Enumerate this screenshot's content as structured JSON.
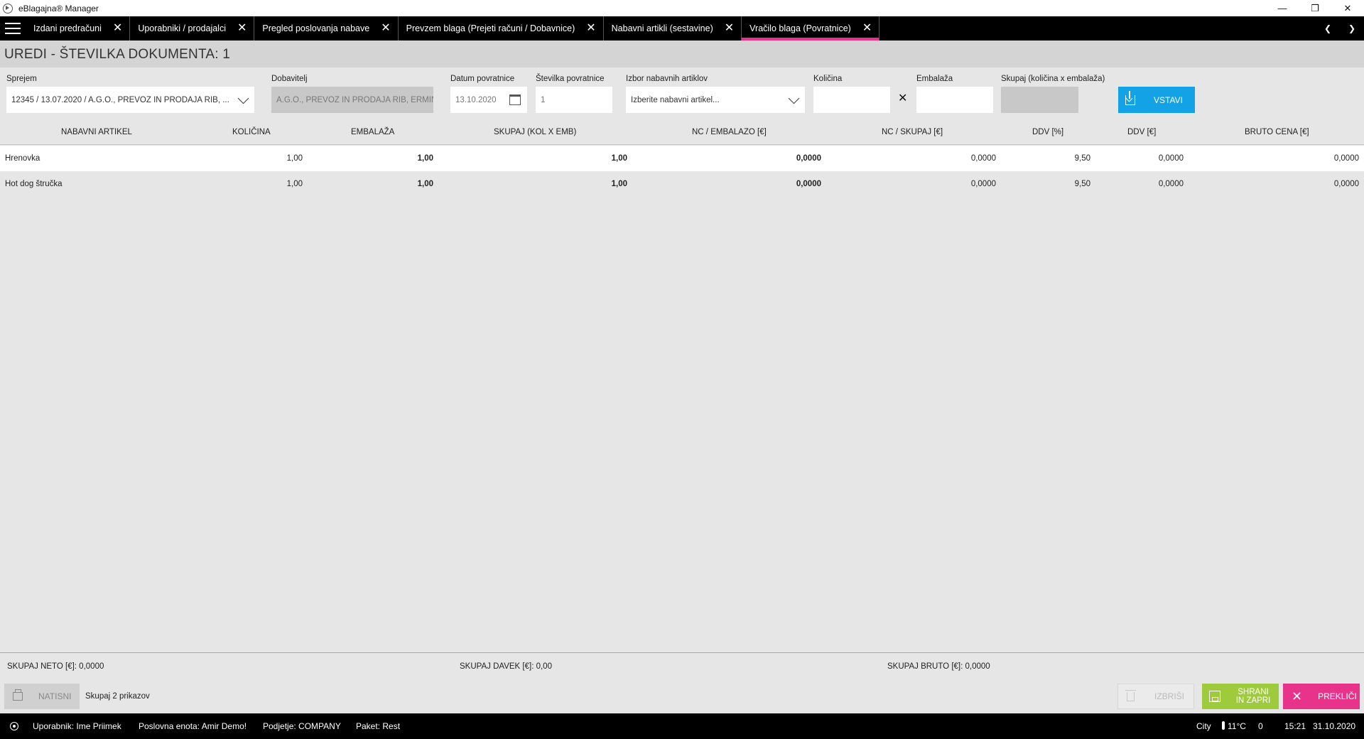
{
  "window": {
    "title": "eBlagajna® Manager",
    "minimize": "—",
    "restore": "❐",
    "close": "✕"
  },
  "tabs": [
    {
      "label": "Izdani predračuni",
      "active": false
    },
    {
      "label": "Uporabniki / prodajalci",
      "active": false
    },
    {
      "label": "Pregled poslovanja nabave",
      "active": false
    },
    {
      "label": "Prevzem blaga (Prejeti računi / Dobavnice)",
      "active": false
    },
    {
      "label": "Nabavni artikli (sestavine)",
      "active": false
    },
    {
      "label": "Vračilo blaga (Povratnice)",
      "active": true
    }
  ],
  "tab_close": "✕",
  "tab_nav": {
    "prev": "❮",
    "next": "❯"
  },
  "page": {
    "title": "UREDI - ŠTEVILKA DOKUMENTA: 1"
  },
  "form": {
    "sprejem_label": "Sprejem",
    "sprejem_value": "12345 / 13.07.2020 / A.G.O., PREVOZ IN PRODAJA RIB, ...",
    "dobavitelj_label": "Dobavitelj",
    "dobavitelj_value": "A.G.O., PREVOZ IN PRODAJA RIB, ERMIN",
    "datum_label": "Datum povratnice",
    "datum_value": "13.10.2020",
    "stevilka_label": "Številka povratnice",
    "stevilka_value": "1",
    "izbor_label": "Izbor nabavnih artiklov",
    "izbor_placeholder": "Izberite nabavni artikel...",
    "kolicina_label": "Količina",
    "kolicina_value": "",
    "multiply_sign": "✕",
    "embalaza_label": "Embalaža",
    "embalaza_value": "",
    "skupaj_label": "Skupaj (količina x embalaža)",
    "skupaj_value": "",
    "insert_button": "VSTAVI"
  },
  "table": {
    "columns": [
      "NABAVNI ARTIKEL",
      "KOLIČINA",
      "EMBALAŽA",
      "SKUPAJ (KOL X EMB)",
      "NC / EMBALAZO [€]",
      "NC / SKUPAJ [€]",
      "DDV [%]",
      "DDV [€]",
      "BRUTO CENA [€]"
    ],
    "rows": [
      {
        "artikel": "Hrenovka",
        "kolicina": "1,00",
        "embalaza": "1,00",
        "skupaj": "1,00",
        "nc_emb": "0,0000",
        "nc_skupaj": "0,0000",
        "ddv_pct": "9,50",
        "ddv_eur": "0,0000",
        "bruto": "0,0000"
      },
      {
        "artikel": "Hot dog štručka",
        "kolicina": "1,00",
        "embalaza": "1,00",
        "skupaj": "1,00",
        "nc_emb": "0,0000",
        "nc_skupaj": "0,0000",
        "ddv_pct": "9,50",
        "ddv_eur": "0,0000",
        "bruto": "0,0000"
      }
    ]
  },
  "totals": {
    "neto": "SKUPAJ NETO [€]: 0,0000",
    "davek": "SKUPAJ DAVEK [€]: 0,00",
    "bruto": "SKUPAJ BRUTO [€]: 0,0000"
  },
  "actions": {
    "print": "NATISNI",
    "count": "Skupaj 2 prikazov",
    "delete": "IZBRIŠI",
    "save": "SHRANI IN ZAPRI",
    "cancel": "PREKLIČI"
  },
  "status": {
    "user": "Uporabnik: Ime Priimek",
    "unit": "Poslovna enota: Amir Demo!",
    "company": "Podjetje: COMPANY",
    "package": "Paket: Rest",
    "city": "City",
    "temperature": "11°C",
    "extra": "0",
    "time": "15:21",
    "date": "31.10.2020"
  },
  "colors": {
    "accent_pink": "#e8338a",
    "insert_blue": "#13a2e6",
    "save_green": "#9ecb3c"
  }
}
